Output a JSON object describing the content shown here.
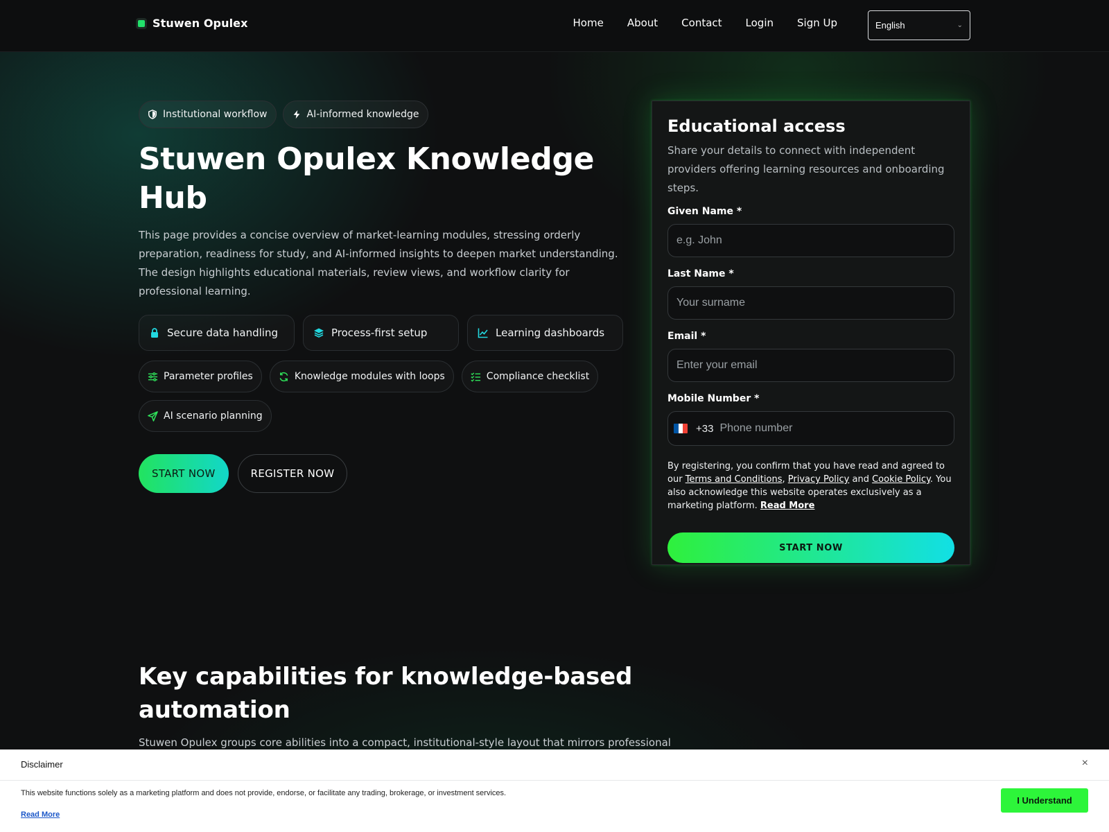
{
  "colors": {
    "accent_green": "#22e35f",
    "accent_cyan": "#12d7c9",
    "background": "#0f1011"
  },
  "nav": {
    "brand": "Stuwen Opulex",
    "links": [
      "Home",
      "About",
      "Contact",
      "Login",
      "Sign Up"
    ],
    "language": "English"
  },
  "hero": {
    "badges": [
      {
        "icon": "shield-icon",
        "label": "Institutional workflow"
      },
      {
        "icon": "bolt-icon",
        "label": "AI-informed knowledge"
      }
    ],
    "title": "Stuwen Opulex Knowledge Hub",
    "description": "This page provides a concise overview of market-learning modules, stressing orderly preparation, readiness for study, and AI-informed insights to deepen market understanding. The design highlights educational materials, review views, and workflow clarity for professional learning.",
    "features": [
      {
        "icon": "lock-icon",
        "label": "Secure data handling"
      },
      {
        "icon": "layers-icon",
        "label": "Process-first setup"
      },
      {
        "icon": "line-chart-icon",
        "label": "Learning dashboards"
      }
    ],
    "chips": [
      {
        "icon": "sliders-icon",
        "label": "Parameter profiles"
      },
      {
        "icon": "refresh-icon",
        "label": "Knowledge modules with loops"
      },
      {
        "icon": "checklist-icon",
        "label": "Compliance checklist"
      },
      {
        "icon": "send-icon",
        "label": "AI scenario planning"
      }
    ],
    "cta_primary": "START NOW",
    "cta_secondary": "REGISTER NOW"
  },
  "form": {
    "title": "Educational access",
    "subtitle": "Share your details to connect with independent providers offering learning resources and onboarding steps.",
    "given_name_label": "Given Name *",
    "given_name_placeholder": "e.g. John",
    "last_name_label": "Last Name *",
    "last_name_placeholder": "Your surname",
    "email_label": "Email *",
    "email_placeholder": "Enter your email",
    "mobile_label": "Mobile Number *",
    "dial_code": "+33",
    "phone_placeholder": "Phone number",
    "consent": {
      "prefix": "By registering, you confirm that you have read and agreed to our ",
      "terms": "Terms and Conditions",
      "sep1": ", ",
      "privacy": "Privacy Policy",
      "sep2": " and ",
      "cookie": "Cookie Policy",
      "suffix": ". You also acknowledge this website operates exclusively as a marketing platform. ",
      "read_more": "Read More"
    },
    "submit": "START NOW"
  },
  "section2": {
    "title": "Key capabilities for knowledge-based automation",
    "description": "Stuwen Opulex groups core abilities into a compact, institutional-style layout that mirrors professional learning workflows. Each module explains how AI-informed resources support configuration, monitoring, and consistent operations across learning pathways."
  },
  "disclaimer": {
    "title": "Disclaimer",
    "close": "×",
    "text": "This website functions solely as a marketing platform and does not provide, endorse, or facilitate any trading, brokerage, or investment services.",
    "read_more": "Read More",
    "button": "I Understand"
  }
}
